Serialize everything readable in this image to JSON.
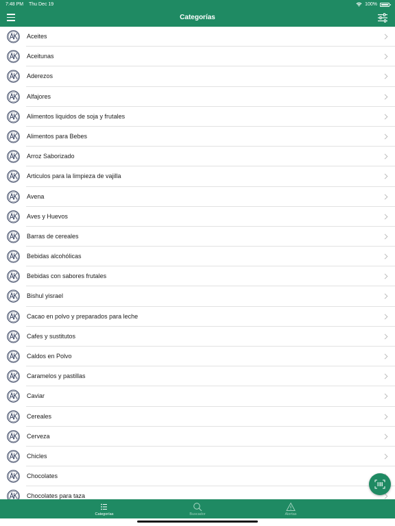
{
  "status_bar": {
    "time": "7:48 PM",
    "date": "Thu Dec 19",
    "battery": "100%"
  },
  "header": {
    "title": "Categorías",
    "left_icon": "hamburger-menu-icon",
    "right_icon": "filter-sliders-icon"
  },
  "categories": [
    {
      "label": "Aceites"
    },
    {
      "label": "Aceitunas"
    },
    {
      "label": "Aderezos"
    },
    {
      "label": "Alfajores"
    },
    {
      "label": "Alimentos liquidos de soja y frutales"
    },
    {
      "label": "Alimentos para Bebes"
    },
    {
      "label": "Arroz Saborizado"
    },
    {
      "label": "Articulos para la limpieza de vajilla"
    },
    {
      "label": "Avena"
    },
    {
      "label": "Aves y Huevos"
    },
    {
      "label": "Barras de cereales"
    },
    {
      "label": "Bebidas alcohólicas"
    },
    {
      "label": "Bebidas con sabores frutales"
    },
    {
      "label": "Bishul yisrael"
    },
    {
      "label": "Cacao en polvo y preparados para leche"
    },
    {
      "label": "Cafes y sustitutos"
    },
    {
      "label": "Caldos en Polvo"
    },
    {
      "label": "Caramelos y pastillas"
    },
    {
      "label": "Caviar"
    },
    {
      "label": "Cereales"
    },
    {
      "label": "Cerveza"
    },
    {
      "label": "Chicles"
    },
    {
      "label": "Chocolates"
    },
    {
      "label": "Chocolates para taza"
    }
  ],
  "fab": {
    "icon": "barcode-scan-icon"
  },
  "tabs": [
    {
      "label": "Categorías",
      "icon": "list-icon",
      "active": true
    },
    {
      "label": "Buscador",
      "icon": "search-icon",
      "active": false
    },
    {
      "label": "Alertas",
      "icon": "warning-icon",
      "active": false
    }
  ],
  "colors": {
    "primary": "#1f8a63",
    "separator": "#e2e2e2",
    "chevron": "#b8b8b8",
    "logo": "#2f3b5a"
  }
}
